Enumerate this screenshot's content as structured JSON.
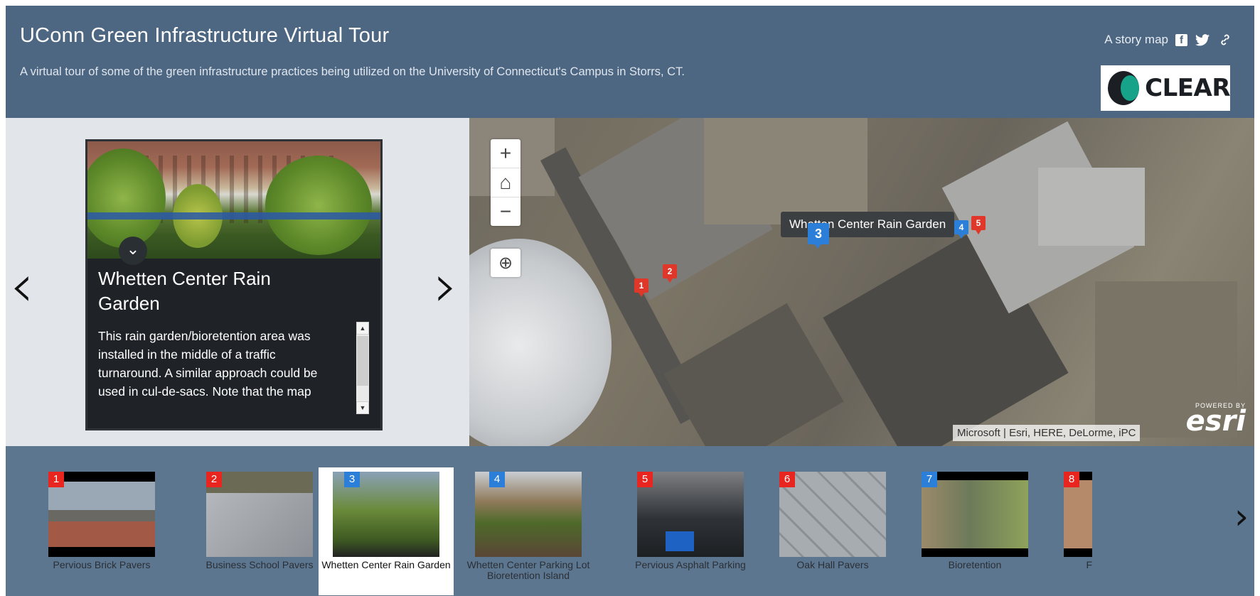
{
  "header": {
    "title": "UConn Green Infrastructure Virtual Tour",
    "subtitle": "A virtual tour of some of the green infrastructure practices being utilized on the University of Connecticut's Campus in Storrs, CT.",
    "story_map_label": "A story map",
    "share_icons": [
      "facebook-icon",
      "twitter-icon",
      "link-icon"
    ],
    "logo_text": "CLEAR",
    "background_color": "#4d6682"
  },
  "panel": {
    "prev_arrow": "‹",
    "next_arrow": "›",
    "collapse_glyph": "⌄",
    "title": "Whetten Center Rain Garden",
    "text": "This rain garden/bioretention area was installed in the middle of a traffic turnaround. A similar approach could be used in cul-de-sacs. Note that the map"
  },
  "map": {
    "zoom_in": "+",
    "home": "⌂",
    "zoom_out": "−",
    "locate": "⊕",
    "tooltip": "Whetten Center Rain Garden",
    "pins": [
      {
        "number": "1",
        "color": "red"
      },
      {
        "number": "2",
        "color": "red"
      },
      {
        "number": "3",
        "color": "blue"
      },
      {
        "number": "4",
        "color": "blue"
      },
      {
        "number": "5",
        "color": "red"
      }
    ],
    "attribution_left": "Microsoft",
    "attribution_right": "Esri, HERE, DeLorme, iPC",
    "powered_by": "POWERED BY",
    "esri_mark": "esri"
  },
  "carousel": {
    "items": [
      {
        "number": "1",
        "label": "Pervious Brick Pavers",
        "marker_color": "#e8251f"
      },
      {
        "number": "2",
        "label": "Business School Pavers",
        "marker_color": "#e8251f"
      },
      {
        "number": "3",
        "label": "Whetten Center Rain Garden",
        "marker_color": "#2b7fd8",
        "selected": true
      },
      {
        "number": "4",
        "label": "Whetten Center Parking Lot Bioretention Island",
        "marker_color": "#2b7fd8"
      },
      {
        "number": "5",
        "label": "Pervious Asphalt Parking",
        "marker_color": "#e8251f"
      },
      {
        "number": "6",
        "label": "Oak Hall Pavers",
        "marker_color": "#e8251f"
      },
      {
        "number": "7",
        "label": "Bioretention",
        "marker_color": "#2b7fd8"
      },
      {
        "number": "8",
        "label": "F",
        "marker_color": "#e8251f"
      }
    ],
    "next_arrow": "›"
  }
}
